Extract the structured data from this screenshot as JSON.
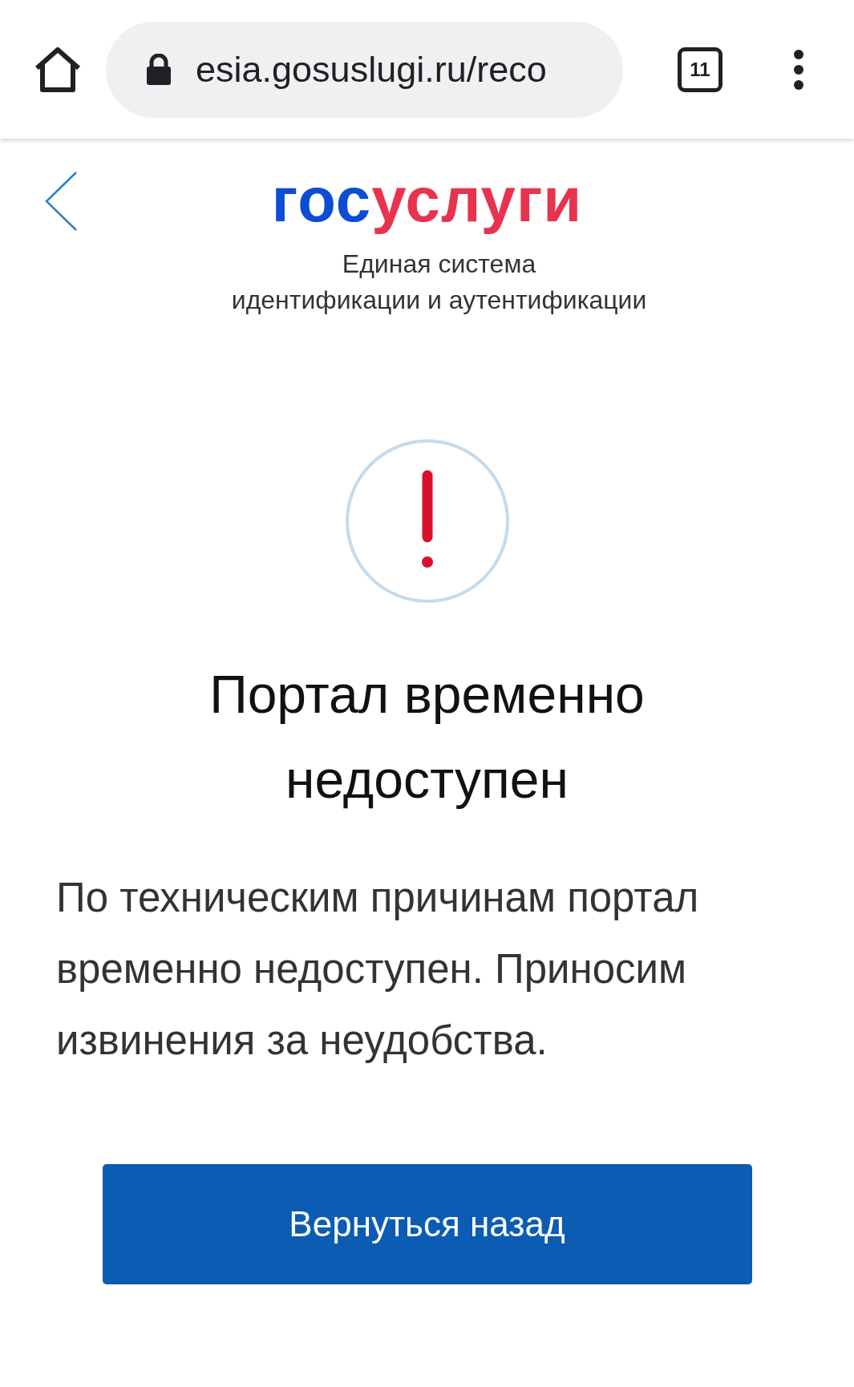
{
  "browser": {
    "url": "esia.gosuslugi.ru/reco",
    "tab_count": "11"
  },
  "header": {
    "logo": [
      {
        "text": "гос",
        "color": "#0d4cd3"
      },
      {
        "text": "услуги",
        "color": "#e8334f"
      }
    ],
    "subtitle": [
      "Единая система",
      "идентификации и аутентификации"
    ]
  },
  "heading": "Портал временно недоступен",
  "message": "По техническим причинам портал временно недоступен. Приносим извинения за неудобства.",
  "button": "Вернуться назад"
}
